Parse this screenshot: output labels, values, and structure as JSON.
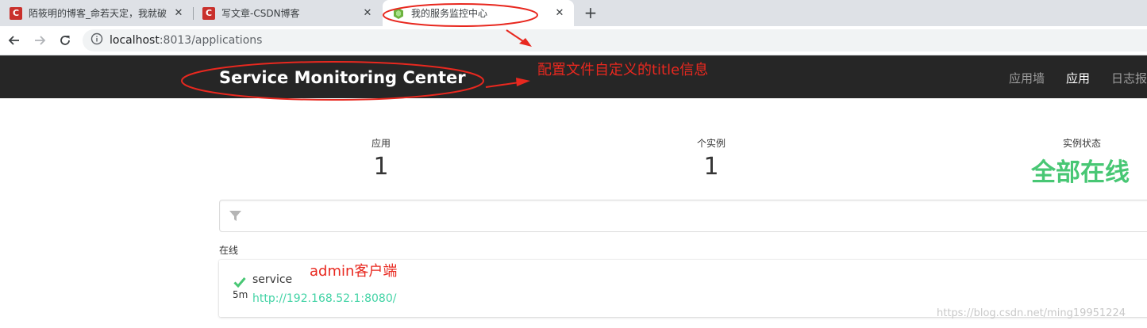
{
  "browser": {
    "tabs": [
      {
        "title": "陌筱明的博客_命若天定，我就破",
        "active": false
      },
      {
        "title": "写文章-CSDN博客",
        "active": false
      },
      {
        "title": "我的服务监控中心",
        "active": true
      }
    ],
    "new_tab": "+",
    "close_glyph": "✕",
    "csdn_glyph": "C",
    "address": {
      "host": "localhost",
      "rest": ":8013/applications"
    }
  },
  "appbar": {
    "brand": "Service Monitoring Center",
    "nav": [
      "应用墙",
      "应用",
      "日志报"
    ],
    "active_nav": "应用"
  },
  "stats": {
    "apps_label": "应用",
    "apps_value": "1",
    "instances_label": "个实例",
    "instances_value": "1",
    "status_label": "实例状态",
    "status_value": "全部在线"
  },
  "group": {
    "label": "在线"
  },
  "application": {
    "name": "service",
    "since": "5m",
    "url": "http://192.168.52.1:8080/"
  },
  "annotations": {
    "title_note": "配置文件自定义的title信息",
    "client_note": "admin客户端"
  },
  "watermark": "https://blog.csdn.net/ming19951224",
  "colors": {
    "accent": "#42d3a5",
    "status_green": "#48c774",
    "annotation_red": "#e8281f",
    "navbar": "#262626"
  }
}
